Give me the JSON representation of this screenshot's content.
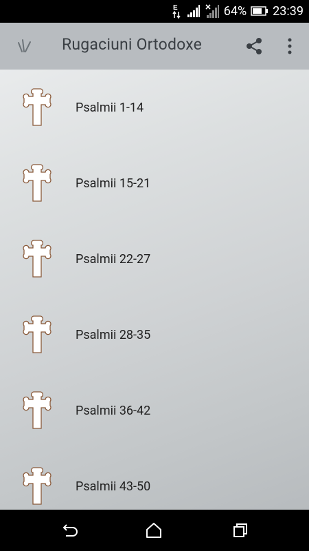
{
  "status_bar": {
    "battery": "64%",
    "time": "23:39",
    "icons": [
      "data-e-icon",
      "signal-icon",
      "signal-no-data-icon",
      "battery-icon"
    ]
  },
  "app_bar": {
    "title": "Rugaciuni Ortodoxe",
    "icons": [
      "app-nav-icon",
      "share-icon",
      "overflow-menu-icon"
    ]
  },
  "list": {
    "items": [
      {
        "label": "Psalmii 1-14",
        "icon": "cross-icon"
      },
      {
        "label": "Psalmii 15-21",
        "icon": "cross-icon"
      },
      {
        "label": "Psalmii 22-27",
        "icon": "cross-icon"
      },
      {
        "label": "Psalmii 28-35",
        "icon": "cross-icon"
      },
      {
        "label": "Psalmii 36-42",
        "icon": "cross-icon"
      },
      {
        "label": "Psalmii 43-50",
        "icon": "cross-icon"
      }
    ]
  },
  "nav_bar": {
    "icons": [
      "back-icon",
      "home-icon",
      "recents-icon"
    ]
  }
}
